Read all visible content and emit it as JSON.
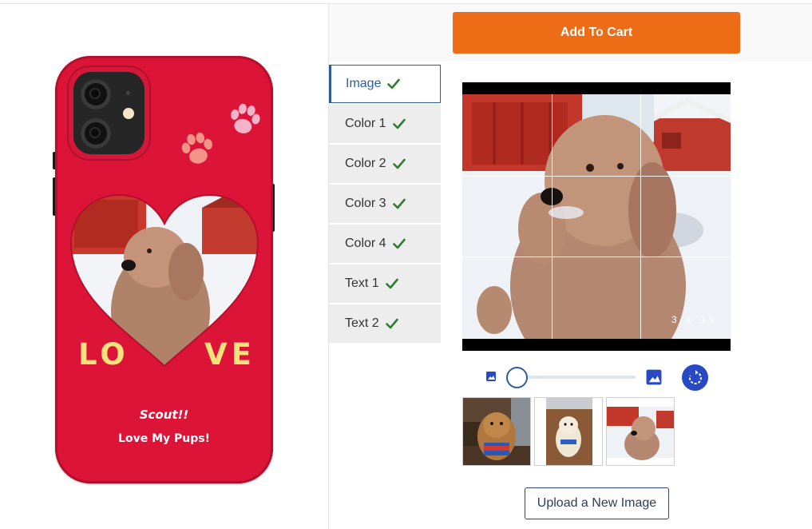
{
  "toolbar": {
    "add_to_cart_label": "Add To Cart"
  },
  "tabs": [
    {
      "label": "Image",
      "active": true,
      "complete": true
    },
    {
      "label": "Color 1",
      "complete": true
    },
    {
      "label": "Color 2",
      "complete": true
    },
    {
      "label": "Color 3",
      "complete": true
    },
    {
      "label": "Color 4",
      "complete": true
    },
    {
      "label": "Text 1",
      "complete": true
    },
    {
      "label": "Text 2",
      "complete": true
    }
  ],
  "preview": {
    "case_color": "#dc1438",
    "love_left": "LO",
    "love_right": "VE",
    "text1": "Scout!!",
    "text2": "Love My Pups!"
  },
  "editor": {
    "photo_watermark": "3 1 19",
    "zoom_level": 0
  },
  "thumbnails": [
    {
      "name": "dog-on-floor-photo"
    },
    {
      "name": "white-puppy-photo"
    },
    {
      "name": "dog-in-snow-photo"
    }
  ],
  "upload_label": "Upload a New Image",
  "colors": {
    "accent": "#ee6c16",
    "primary": "#2f5d9b",
    "rotate": "#2749c4",
    "check": "#2e7d32"
  },
  "icons": [
    "checkmark-icon",
    "image-small-icon",
    "image-large-icon",
    "rotate-icon",
    "paw-icon"
  ]
}
